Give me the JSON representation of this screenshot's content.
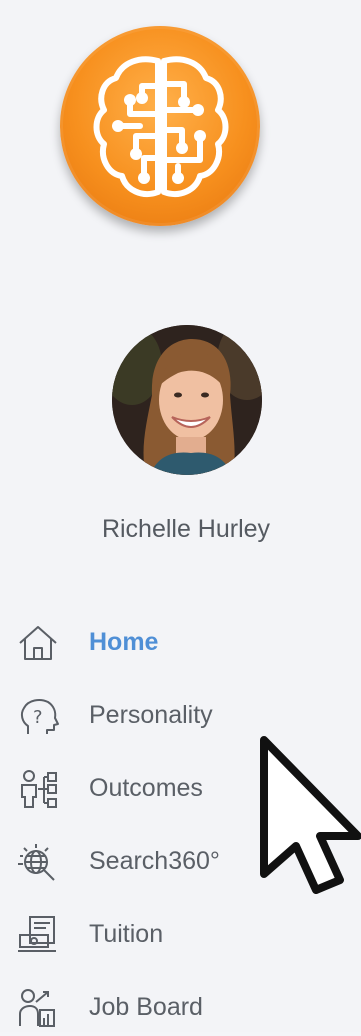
{
  "user": {
    "name": "Richelle Hurley"
  },
  "nav": {
    "items": [
      {
        "label": "Home",
        "icon": "home-icon",
        "active": true
      },
      {
        "label": "Personality",
        "icon": "head-question-icon",
        "active": false
      },
      {
        "label": "Outcomes",
        "icon": "person-flow-icon",
        "active": false
      },
      {
        "label": "Search360°",
        "icon": "globe-search-icon",
        "active": false
      },
      {
        "label": "Tuition",
        "icon": "money-register-icon",
        "active": false
      },
      {
        "label": "Job Board",
        "icon": "job-board-icon",
        "active": false
      }
    ]
  },
  "colors": {
    "accent": "#4f8fd6",
    "logo_orange": "#f7901e",
    "text": "#5a5f66"
  }
}
